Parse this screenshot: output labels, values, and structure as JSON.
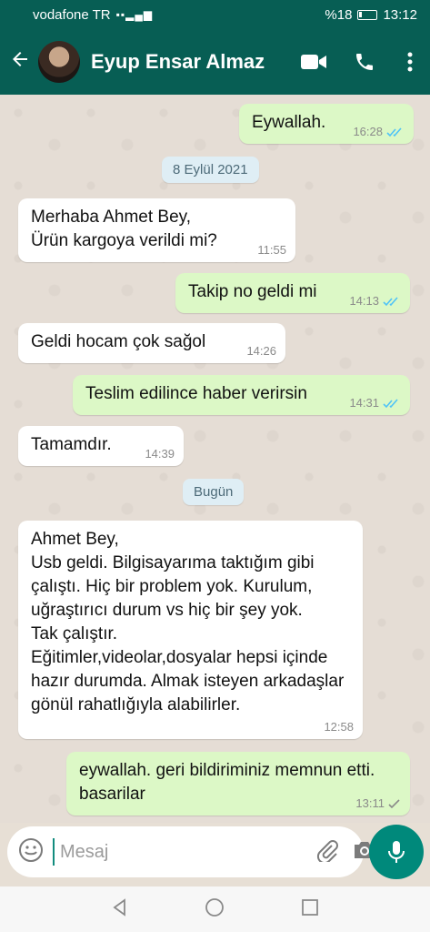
{
  "status_bar": {
    "carrier": "vodafone TR",
    "network_icons": "VoLTE 4.5G",
    "battery": "%18",
    "time": "13:12"
  },
  "header": {
    "contact_name": "Eyup Ensar Almaz",
    "back_icon": "arrow-left-icon",
    "video_icon": "video-call-icon",
    "call_icon": "phone-icon",
    "menu_icon": "more-vert-icon"
  },
  "messages": [
    {
      "direction": "out",
      "text": "Eywallah.",
      "time": "16:28",
      "status": "read"
    },
    {
      "type": "date",
      "text": "8 Eylül 2021"
    },
    {
      "direction": "in",
      "text": "Merhaba Ahmet Bey,\nÜrün kargoya verildi mi?",
      "time": "11:55"
    },
    {
      "direction": "out",
      "text": "Takip no geldi mi",
      "time": "14:13",
      "status": "read"
    },
    {
      "direction": "in",
      "text": "Geldi hocam çok sağol",
      "time": "14:26"
    },
    {
      "direction": "out",
      "text": "Teslim edilince haber verirsin",
      "time": "14:31",
      "status": "read"
    },
    {
      "direction": "in",
      "text": "Tamamdır.",
      "time": "14:39"
    },
    {
      "type": "date",
      "text": "Bugün"
    },
    {
      "direction": "in",
      "text": "Ahmet Bey,\nUsb geldi. Bilgisayarıma taktığım gibi çalıştı. Hiç bir problem yok. Kurulum, uğraştırıcı durum vs hiç bir şey yok.\nTak çalıştır.\nEğitimler,videolar,dosyalar hepsi içinde hazır durumda. Almak isteyen arkadaşlar gönül rahatlığıyla alabilirler.",
      "time": "12:58"
    },
    {
      "direction": "out",
      "text": "eywallah.  geri bildiriminiz memnun etti.  basarilar",
      "time": "13:11",
      "status": "sent"
    }
  ],
  "composer": {
    "placeholder": "Mesaj",
    "emoji_icon": "emoji-icon",
    "attach_icon": "paperclip-icon",
    "camera_icon": "camera-icon",
    "mic_icon": "microphone-icon"
  },
  "colors": {
    "header": "#075e54",
    "outgoing_bubble": "#dcf8c6",
    "incoming_bubble": "#ffffff",
    "read_ticks": "#4fc3f7",
    "mic_button": "#00897b"
  }
}
